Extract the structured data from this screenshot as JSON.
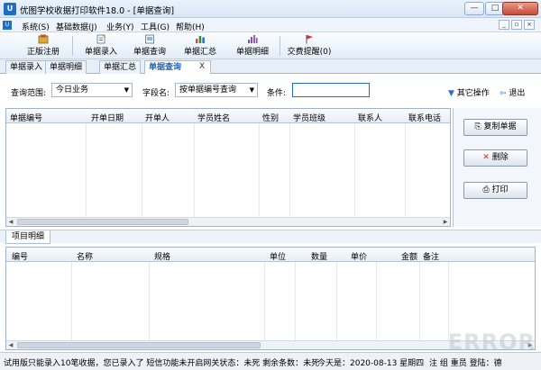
{
  "window": {
    "title": "优图学校收据打印软件18.0 - [单据查询]",
    "icon_label": "U",
    "controls": {
      "minimize": "—",
      "maximize": "□",
      "close": "✕"
    }
  },
  "menubar": {
    "grip_label": "U",
    "items": [
      "系统(S)",
      "基础数据(J)",
      "业务(Y)",
      "工具(G)",
      "帮助(H)"
    ],
    "mdi_controls": [
      "_",
      "▫",
      "×"
    ]
  },
  "toolbar": {
    "buttons": [
      {
        "label": "正版注册",
        "icon": "register-icon"
      },
      {
        "label": "单据录入",
        "icon": "entry-icon"
      },
      {
        "label": "单据查询",
        "icon": "query-icon"
      },
      {
        "label": "单据汇总",
        "icon": "summary-icon"
      },
      {
        "label": "单据明细",
        "icon": "detail-icon"
      },
      {
        "label": "交费提醒(0)",
        "icon": "reminder-flag-icon"
      }
    ]
  },
  "tabs": [
    {
      "label": "单据录入",
      "active": false
    },
    {
      "label": "单据明细",
      "active": false
    },
    {
      "label": "单据汇总",
      "active": false
    },
    {
      "label": "单据查询",
      "active": true
    }
  ],
  "tab_close": "X",
  "filter": {
    "range_label": "查询范围:",
    "range_value": "今日业务",
    "field_label": "字段名:",
    "field_value": "按单据编号查询",
    "condition_label": "条件:",
    "condition_value": "",
    "other_ops": "其它操作",
    "exit": "退出"
  },
  "main_grid": {
    "columns": [
      "单据编号",
      "开单日期",
      "开单人",
      "学员姓名",
      "性别",
      "学员班级",
      "联系人",
      "联系电话"
    ]
  },
  "actions": {
    "copy": "复制单据",
    "delete": "删除",
    "print": "打印"
  },
  "sub_tab": "项目明细",
  "detail_grid": {
    "columns": [
      "编号",
      "名称",
      "规格",
      "单位",
      "数量",
      "单价",
      "金额",
      "备注"
    ]
  },
  "status": {
    "message": "试用版只能录入10笔收据，您已录入了 短信功能未开启网关状态：未死 剩余条数：未死",
    "date": "今天是：2020-08-13 星期四",
    "tail": "注 组 重员 登陆：德"
  },
  "watermark": "ERROR"
}
